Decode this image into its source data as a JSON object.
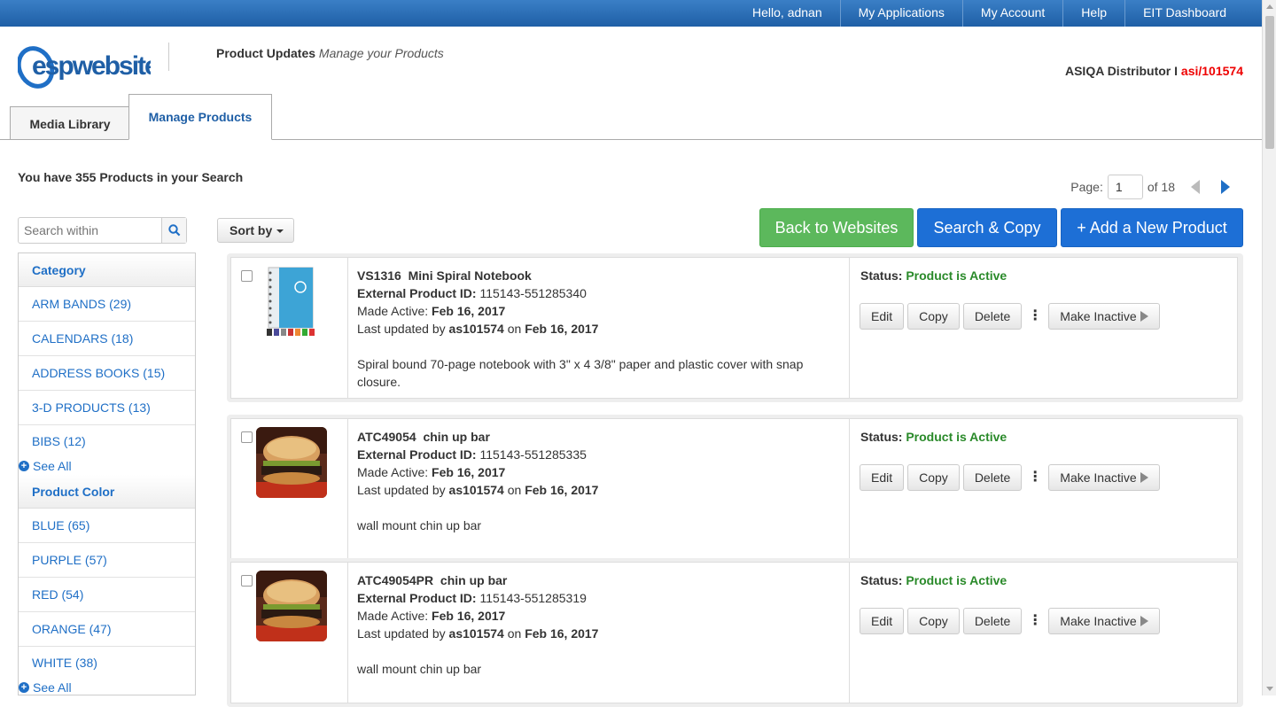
{
  "topnav": {
    "greeting": "Hello, adnan",
    "items": [
      "My Applications",
      "My Account",
      "Help",
      "EIT Dashboard"
    ]
  },
  "logo_text": "espwebsites",
  "header": {
    "title": "Product Updates",
    "subtitle": "Manage your Products",
    "distributor": "ASIQA Distributor I ",
    "asi": "asi/101574"
  },
  "tabs": [
    {
      "label": "Media Library",
      "active": false
    },
    {
      "label": "Manage Products",
      "active": true
    }
  ],
  "result_count": "You have 355 Products in your Search",
  "pager": {
    "label": "Page:",
    "current": "1",
    "of_label": "of 18"
  },
  "search": {
    "placeholder": "Search within"
  },
  "sort": {
    "label": "Sort by"
  },
  "buttons": {
    "back": "Back to Websites",
    "search_copy": "Search & Copy",
    "add": "+ Add a New Product"
  },
  "facets": {
    "category": {
      "title": "Category",
      "items": [
        {
          "name": "ARM BANDS",
          "count": "(29)"
        },
        {
          "name": "CALENDARS",
          "count": "(18)"
        },
        {
          "name": "ADDRESS BOOKS",
          "count": "(15)"
        },
        {
          "name": "3-D PRODUCTS",
          "count": "(13)"
        },
        {
          "name": "BIBS",
          "count": "(12)"
        }
      ],
      "see_all": "See All"
    },
    "color": {
      "title": "Product Color",
      "items": [
        {
          "name": "BLUE",
          "count": "(65)"
        },
        {
          "name": "PURPLE",
          "count": "(57)"
        },
        {
          "name": "RED",
          "count": "(54)"
        },
        {
          "name": "ORANGE",
          "count": "(47)"
        },
        {
          "name": "WHITE",
          "count": "(38)"
        }
      ],
      "see_all": "See All"
    }
  },
  "labels": {
    "external_id": "External Product ID:",
    "made_active": "Made Active:",
    "last_updated": "Last updated by",
    "on": "on",
    "status": "Status:",
    "edit": "Edit",
    "copy": "Copy",
    "delete": "Delete",
    "make_inactive": "Make Inactive"
  },
  "products": [
    {
      "sku": "VS1316",
      "name": "Mini Spiral Notebook",
      "external_id": "115143-551285340",
      "made_active": "Feb 16, 2017",
      "updated_by": "as101574",
      "updated_on": "Feb 16, 2017",
      "description": "Spiral bound 70-page notebook with 3\" x 4 3/8\" paper and plastic cover with snap closure.",
      "status": "Product is Active",
      "image": "notebook"
    },
    {
      "sku": "ATC49054",
      "name": "chin up bar",
      "external_id": "115143-551285335",
      "made_active": "Feb 16, 2017",
      "updated_by": "as101574",
      "updated_on": "Feb 16, 2017",
      "description": "wall mount chin up bar",
      "status": "Product is Active",
      "image": "burger"
    },
    {
      "sku": "ATC49054PR",
      "name": "chin up bar",
      "external_id": "115143-551285319",
      "made_active": "Feb 16, 2017",
      "updated_by": "as101574",
      "updated_on": "Feb 16, 2017",
      "description": "wall mount chin up bar",
      "status": "Product is Active",
      "image": "burger"
    }
  ]
}
